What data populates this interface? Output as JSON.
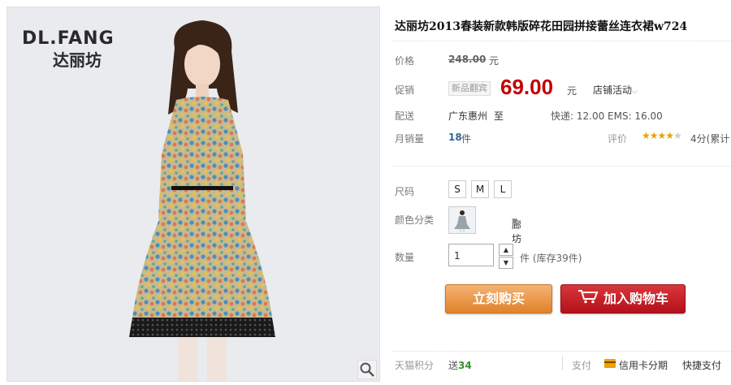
{
  "brand": {
    "name_en": "DL.FANG",
    "name_cn": "达丽坊"
  },
  "product": {
    "title": "达丽坊2013春装新款韩版碎花田园拼接蕾丝连衣裙w724",
    "labels": {
      "price": "价格",
      "promo": "促销",
      "delivery": "配送",
      "monthly_sales": "月销量",
      "rating": "评价",
      "size": "尺码",
      "color": "颜色分类",
      "quantity": "数量",
      "points": "天猫积分",
      "payment": "支付"
    },
    "original_price": "248.00",
    "currency_unit": "元",
    "promo_tag": "新品翻宾",
    "promo_price": "69.00",
    "shop_activity": "店铺活动",
    "delivery": {
      "from": "广东惠州",
      "to_word": "至",
      "to": "廊坊",
      "fee": "快递: 12.00 EMS: 16.00"
    },
    "monthly_sales": {
      "count": "18",
      "unit": "件"
    },
    "rating": {
      "stars": 4,
      "max": 5,
      "text": "4分(累计"
    },
    "sizes": [
      "S",
      "M",
      "L"
    ],
    "quantity": {
      "value": "1",
      "stock_text": "件 (库存39件)"
    },
    "buttons": {
      "buy_now": "立刻购买",
      "add_to_cart": "加入购物车"
    },
    "points": {
      "prefix": "送",
      "value": "34"
    },
    "payment": {
      "credit_installment": "信用卡分期",
      "quick_pay": "快捷支付"
    }
  },
  "colors": {
    "price_red": "#c40000",
    "buy_orange": "#e0822a",
    "cart_red": "#b4101a",
    "star_gold": "#e9a200"
  },
  "icons": [
    "zoom-icon",
    "chevron-down-icon",
    "star-icon",
    "caret-up-icon",
    "caret-down-icon",
    "cart-icon",
    "credit-card-icon"
  ]
}
